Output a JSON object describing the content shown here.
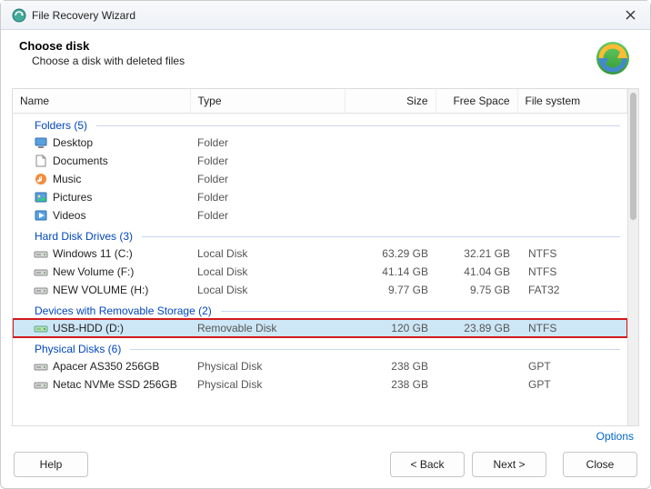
{
  "window": {
    "title": "File Recovery Wizard"
  },
  "header": {
    "title": "Choose disk",
    "subtitle": "Choose a disk with deleted files"
  },
  "columns": {
    "name": "Name",
    "type": "Type",
    "size": "Size",
    "free": "Free Space",
    "fs": "File system"
  },
  "groups": [
    {
      "label": "Folders (5)",
      "items": [
        {
          "icon": "desktop",
          "name": "Desktop",
          "type": "Folder",
          "size": "",
          "free": "",
          "fs": ""
        },
        {
          "icon": "documents",
          "name": "Documents",
          "type": "Folder",
          "size": "",
          "free": "",
          "fs": ""
        },
        {
          "icon": "music",
          "name": "Music",
          "type": "Folder",
          "size": "",
          "free": "",
          "fs": ""
        },
        {
          "icon": "pictures",
          "name": "Pictures",
          "type": "Folder",
          "size": "",
          "free": "",
          "fs": ""
        },
        {
          "icon": "videos",
          "name": "Videos",
          "type": "Folder",
          "size": "",
          "free": "",
          "fs": ""
        }
      ]
    },
    {
      "label": "Hard Disk Drives (3)",
      "items": [
        {
          "icon": "drive",
          "name": "Windows 11 (C:)",
          "type": "Local Disk",
          "size": "63.29 GB",
          "free": "32.21 GB",
          "fs": "NTFS"
        },
        {
          "icon": "drive",
          "name": "New Volume (F:)",
          "type": "Local Disk",
          "size": "41.14 GB",
          "free": "41.04 GB",
          "fs": "NTFS"
        },
        {
          "icon": "drive",
          "name": "NEW VOLUME (H:)",
          "type": "Local Disk",
          "size": "9.77 GB",
          "free": "9.75 GB",
          "fs": "FAT32"
        }
      ]
    },
    {
      "label": "Devices with Removable Storage (2)",
      "items": [
        {
          "icon": "usb",
          "name": "USB-HDD (D:)",
          "type": "Removable Disk",
          "size": "120 GB",
          "free": "23.89 GB",
          "fs": "NTFS",
          "selected": true,
          "highlight": true
        }
      ]
    },
    {
      "label": "Physical Disks (6)",
      "items": [
        {
          "icon": "drive",
          "name": "Apacer AS350 256GB",
          "type": "Physical Disk",
          "size": "238 GB",
          "free": "",
          "fs": "GPT"
        },
        {
          "icon": "drive",
          "name": "Netac NVMe SSD 256GB",
          "type": "Physical Disk",
          "size": "238 GB",
          "free": "",
          "fs": "GPT"
        }
      ]
    }
  ],
  "links": {
    "options": "Options"
  },
  "buttons": {
    "help": "Help",
    "back": "< Back",
    "next": "Next >",
    "close": "Close"
  }
}
